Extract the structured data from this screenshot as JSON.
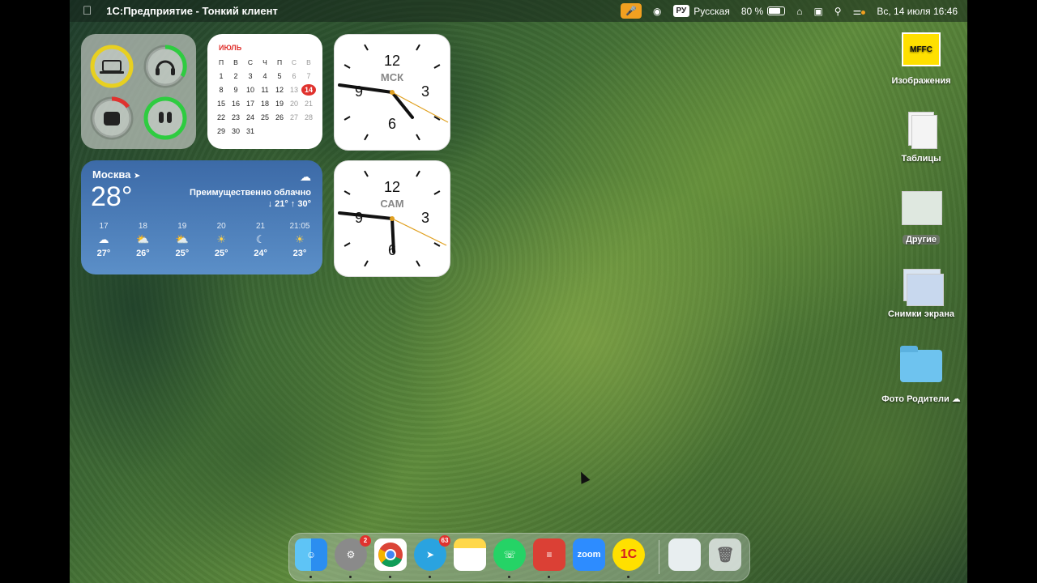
{
  "menubar": {
    "app_name": "1С:Предприятие - Тонкий клиент",
    "lang_code": "РУ",
    "lang_name": "Русская",
    "battery": "80 %",
    "datetime": "Вс, 14 июля  16:46"
  },
  "calendar": {
    "month": "ИЮЛЬ",
    "weekdays": [
      "П",
      "В",
      "С",
      "Ч",
      "П",
      "С",
      "В"
    ],
    "today": 14
  },
  "clocks": [
    {
      "label": "МСК",
      "h12": "12",
      "h3": "3",
      "h6": "6",
      "h9": "9"
    },
    {
      "label": "САМ",
      "h12": "12",
      "h3": "3",
      "h6": "6",
      "h9": "9"
    }
  ],
  "weather": {
    "city": "Москва",
    "temp": "28°",
    "condition": "Преимущественно облачно",
    "range": "↓ 21° ↑ 30°",
    "forecast": [
      {
        "h": "17",
        "icon": "cloud-rain",
        "t": "27°"
      },
      {
        "h": "18",
        "icon": "sun-cloud",
        "t": "26°"
      },
      {
        "h": "19",
        "icon": "sun-cloud",
        "t": "25°"
      },
      {
        "h": "20",
        "icon": "sun",
        "t": "25°"
      },
      {
        "h": "21",
        "icon": "moon",
        "t": "24°"
      },
      {
        "h": "21:05",
        "icon": "sunset",
        "t": "23°"
      }
    ]
  },
  "desktop": {
    "images_label": "Изображения",
    "images_logo": "MFFC",
    "tables_label": "Таблицы",
    "others_label": "Другие",
    "screens_label": "Снимки экрана",
    "photos_label": "Фото Родители"
  },
  "dock": {
    "settings_badge": "2",
    "telegram_badge": "63",
    "zoom_label": "zoom",
    "onec_label": "1С"
  }
}
